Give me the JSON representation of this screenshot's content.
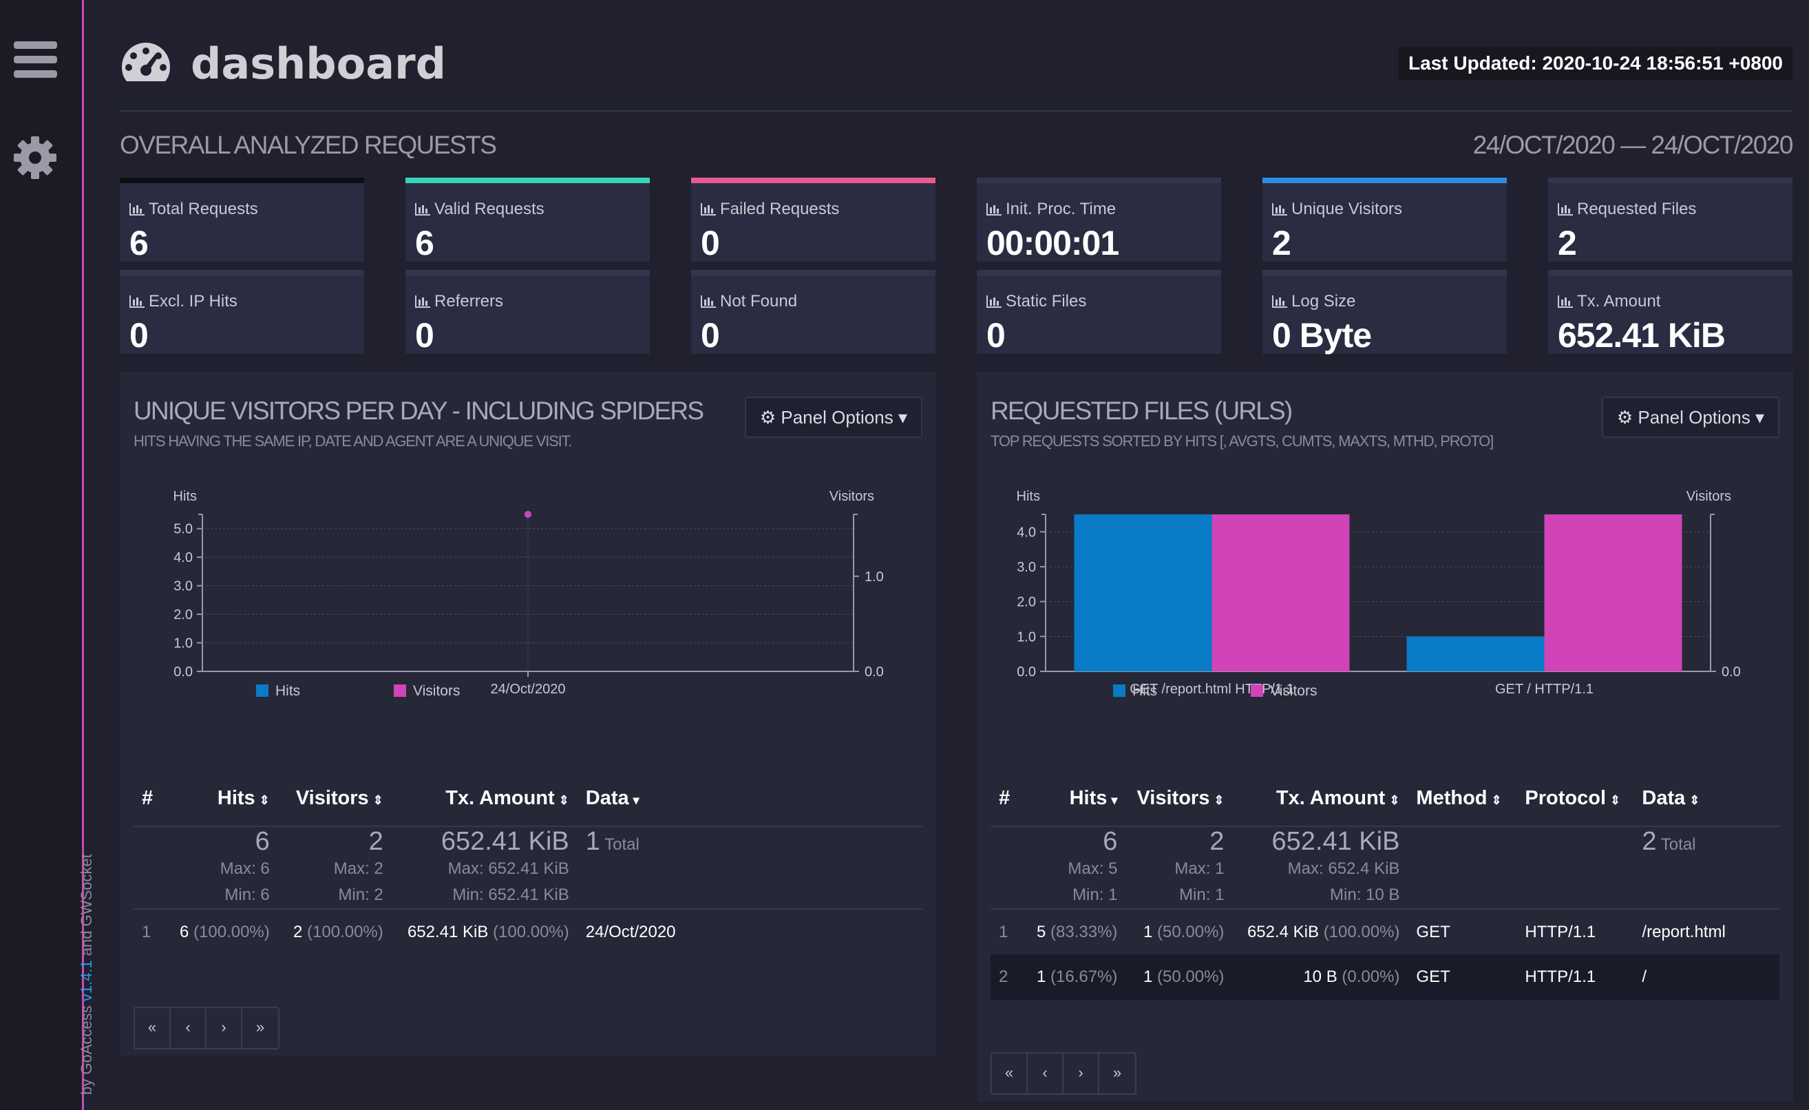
{
  "sidebar": {
    "menu_icon": "hamburger-icon",
    "settings_icon": "gear-icon",
    "footer_prefix": "by GoAccess ",
    "footer_version": "v1.4.1",
    "footer_suffix": " and GWSocket"
  },
  "header": {
    "logo_icon": "speedometer-icon",
    "title": "dashboard",
    "last_updated": "Last Updated: 2020-10-24 18:56:51 +0800"
  },
  "overview": {
    "heading": "OVERALL ANALYZED REQUESTS",
    "date_range": "24/OCT/2020 — 24/OCT/2020",
    "cards": [
      {
        "label": "Total Requests",
        "value": "6",
        "accent": "#0d0d14"
      },
      {
        "label": "Valid Requests",
        "value": "6",
        "accent": "#35d6b8"
      },
      {
        "label": "Failed Requests",
        "value": "0",
        "accent": "#ea5a8e"
      },
      {
        "label": "Init. Proc. Time",
        "value": "00:00:01",
        "accent": "#33354d"
      },
      {
        "label": "Unique Visitors",
        "value": "2",
        "accent": "#2f8de8"
      },
      {
        "label": "Requested Files",
        "value": "2",
        "accent": "#33354d"
      },
      {
        "label": "Excl. IP Hits",
        "value": "0",
        "accent": "#33354d"
      },
      {
        "label": "Referrers",
        "value": "0",
        "accent": "#33354d"
      },
      {
        "label": "Not Found",
        "value": "0",
        "accent": "#33354d"
      },
      {
        "label": "Static Files",
        "value": "0",
        "accent": "#33354d"
      },
      {
        "label": "Log Size",
        "value": "0 Byte",
        "accent": "#33354d"
      },
      {
        "label": "Tx. Amount",
        "value": "652.41 KiB",
        "accent": "#33354d"
      }
    ]
  },
  "colors": {
    "hits": "#0a7bc6",
    "visitors": "#d044b8"
  },
  "visitors_panel": {
    "title": "UNIQUE VISITORS PER DAY - INCLUDING SPIDERS",
    "subtitle": "HITS HAVING THE SAME IP, DATE AND AGENT ARE A UNIQUE VISIT.",
    "options_label": "Panel Options",
    "columns": [
      "#",
      "Hits",
      "Visitors",
      "Tx. Amount",
      "Data"
    ],
    "summary": {
      "hits": "6",
      "hits_max": "Max: 6",
      "hits_min": "Min: 6",
      "visitors": "2",
      "visitors_max": "Max: 2",
      "visitors_min": "Min: 2",
      "tx": "652.41 KiB",
      "tx_max": "Max: 652.41 KiB",
      "tx_min": "Min: 652.41 KiB",
      "data_count": "1",
      "data_label": "Total"
    },
    "rows": [
      {
        "idx": "1",
        "hits": "6",
        "hits_pct": "(100.00%)",
        "visitors": "2",
        "visitors_pct": "(100.00%)",
        "tx": "652.41 KiB",
        "tx_pct": "(100.00%)",
        "data": "24/Oct/2020"
      }
    ],
    "pager": [
      "«",
      "‹",
      "›",
      "»"
    ]
  },
  "files_panel": {
    "title": "REQUESTED FILES (URLS)",
    "subtitle": "TOP REQUESTS SORTED BY HITS [, AVGTS, CUMTS, MAXTS, MTHD, PROTO]",
    "options_label": "Panel Options",
    "columns": [
      "#",
      "Hits",
      "Visitors",
      "Tx. Amount",
      "Method",
      "Protocol",
      "Data"
    ],
    "summary": {
      "hits": "6",
      "hits_max": "Max: 5",
      "hits_min": "Min: 1",
      "visitors": "2",
      "visitors_max": "Max: 1",
      "visitors_min": "Min: 1",
      "tx": "652.41 KiB",
      "tx_max": "Max: 652.4 KiB",
      "tx_min": "Min: 10 B",
      "data_count": "2",
      "data_label": "Total"
    },
    "rows": [
      {
        "idx": "1",
        "hits": "5",
        "hits_pct": "(83.33%)",
        "visitors": "1",
        "visitors_pct": "(50.00%)",
        "tx": "652.4 KiB",
        "tx_pct": "(100.00%)",
        "method": "GET",
        "protocol": "HTTP/1.1",
        "data": "/report.html"
      },
      {
        "idx": "2",
        "hits": "1",
        "hits_pct": "(16.67%)",
        "visitors": "1",
        "visitors_pct": "(50.00%)",
        "tx": "10 B",
        "tx_pct": "(0.00%)",
        "method": "GET",
        "protocol": "HTTP/1.1",
        "data": "/"
      }
    ],
    "pager": [
      "«",
      "‹",
      "›",
      "»"
    ]
  },
  "chart_data": [
    {
      "type": "line",
      "ylabel": "Hits",
      "y2label": "Visitors",
      "categories": [
        "24/Oct/2020"
      ],
      "yticks": [
        "0.0",
        "1.0",
        "2.0",
        "3.0",
        "4.0",
        "5.0"
      ],
      "y2ticks": [
        "0.0",
        "1.0"
      ],
      "series": [
        {
          "name": "Hits",
          "values": [
            6
          ],
          "axis": "left"
        },
        {
          "name": "Visitors",
          "values": [
            2
          ],
          "axis": "right"
        }
      ],
      "legend": "bottom"
    },
    {
      "type": "bar",
      "ylabel": "Hits",
      "y2label": "Visitors",
      "categories": [
        "GET /report.html HTTP/1.1",
        "GET / HTTP/1.1"
      ],
      "yticks": [
        "0.0",
        "1.0",
        "2.0",
        "3.0",
        "4.0"
      ],
      "y2ticks": [
        "0.0"
      ],
      "series": [
        {
          "name": "Hits",
          "values": [
            5,
            1
          ],
          "axis": "left"
        },
        {
          "name": "Visitors",
          "values": [
            1,
            1
          ],
          "axis": "right"
        }
      ],
      "legend": "bottom"
    }
  ]
}
